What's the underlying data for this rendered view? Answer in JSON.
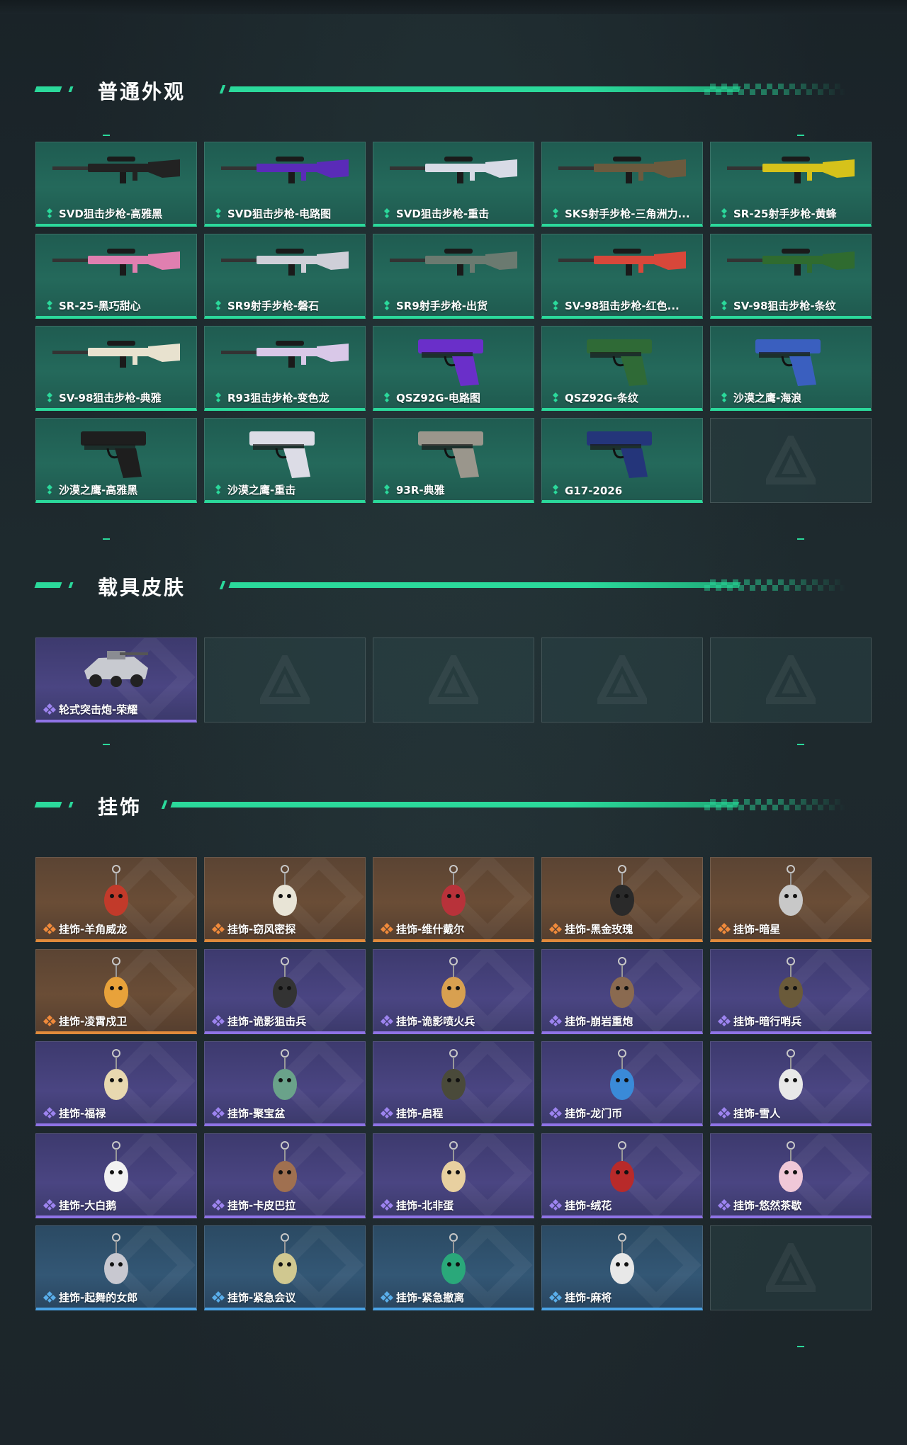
{
  "colors": {
    "accent": "#2bd99b",
    "common": "#2bd99b",
    "epic": "#8f73e6",
    "legendary": "#e08a3b",
    "rare": "#4aa3e6"
  },
  "sections": {
    "weapons": {
      "title": "普通外观",
      "items": [
        {
          "label": "SVD狙击步枪-高雅黑",
          "rarity": "green",
          "icon": "rifle-icon"
        },
        {
          "label": "SVD狙击步枪-电路图",
          "rarity": "green",
          "icon": "rifle-icon"
        },
        {
          "label": "SVD狙击步枪-重击",
          "rarity": "green",
          "icon": "rifle-icon"
        },
        {
          "label": "SKS射手步枪-三角洲力...",
          "rarity": "green",
          "icon": "rifle-icon"
        },
        {
          "label": "SR-25射手步枪-黄蜂",
          "rarity": "green",
          "icon": "rifle-icon"
        },
        {
          "label": "SR-25-黑巧甜心",
          "rarity": "green",
          "icon": "rifle-icon"
        },
        {
          "label": "SR9射手步枪-磐石",
          "rarity": "green",
          "icon": "rifle-icon"
        },
        {
          "label": "SR9射手步枪-出货",
          "rarity": "green",
          "icon": "rifle-icon"
        },
        {
          "label": "SV-98狙击步枪-红色...",
          "rarity": "green",
          "icon": "rifle-icon"
        },
        {
          "label": "SV-98狙击步枪-条纹",
          "rarity": "green",
          "icon": "rifle-icon"
        },
        {
          "label": "SV-98狙击步枪-典雅",
          "rarity": "green",
          "icon": "rifle-icon"
        },
        {
          "label": "R93狙击步枪-变色龙",
          "rarity": "green",
          "icon": "rifle-icon"
        },
        {
          "label": "QSZ92G-电路图",
          "rarity": "green",
          "icon": "pistol-icon"
        },
        {
          "label": "QSZ92G-条纹",
          "rarity": "green",
          "icon": "pistol-icon"
        },
        {
          "label": "沙漠之鹰-海浪",
          "rarity": "green",
          "icon": "pistol-icon"
        },
        {
          "label": "沙漠之鹰-高雅黑",
          "rarity": "green",
          "icon": "pistol-icon"
        },
        {
          "label": "沙漠之鹰-重击",
          "rarity": "green",
          "icon": "pistol-icon"
        },
        {
          "label": "93R-典雅",
          "rarity": "green",
          "icon": "pistol-icon"
        },
        {
          "label": "G17-2026",
          "rarity": "green",
          "icon": "pistol-icon"
        }
      ]
    },
    "vehicles": {
      "title": "载具皮肤",
      "items": [
        {
          "label": "轮式突击炮-荣耀",
          "rarity": "purple",
          "icon": "vehicle-icon"
        }
      ]
    },
    "charms": {
      "title": "挂饰",
      "items": [
        {
          "label": "挂饰-羊角威龙",
          "rarity": "orange",
          "icon": "charm-icon"
        },
        {
          "label": "挂饰-窃风密探",
          "rarity": "orange",
          "icon": "charm-icon"
        },
        {
          "label": "挂饰-维什戴尔",
          "rarity": "orange",
          "icon": "charm-icon"
        },
        {
          "label": "挂饰-黑金玫瑰",
          "rarity": "orange",
          "icon": "charm-icon"
        },
        {
          "label": "挂饰-暗星",
          "rarity": "orange",
          "icon": "charm-icon"
        },
        {
          "label": "挂饰-凌霄戍卫",
          "rarity": "orange",
          "icon": "charm-icon"
        },
        {
          "label": "挂饰-诡影狙击兵",
          "rarity": "purple",
          "icon": "charm-icon"
        },
        {
          "label": "挂饰-诡影喷火兵",
          "rarity": "purple",
          "icon": "charm-icon"
        },
        {
          "label": "挂饰-崩岩重炮",
          "rarity": "purple",
          "icon": "charm-icon"
        },
        {
          "label": "挂饰-暗行哨兵",
          "rarity": "purple",
          "icon": "charm-icon"
        },
        {
          "label": "挂饰-福禄",
          "rarity": "purple",
          "icon": "charm-icon"
        },
        {
          "label": "挂饰-聚宝盆",
          "rarity": "purple",
          "icon": "charm-icon"
        },
        {
          "label": "挂饰-启程",
          "rarity": "purple",
          "icon": "charm-icon"
        },
        {
          "label": "挂饰-龙门币",
          "rarity": "purple",
          "icon": "charm-icon"
        },
        {
          "label": "挂饰-雪人",
          "rarity": "purple",
          "icon": "charm-icon"
        },
        {
          "label": "挂饰-大白鹅",
          "rarity": "purple",
          "icon": "charm-icon"
        },
        {
          "label": "挂饰-卡皮巴拉",
          "rarity": "purple",
          "icon": "charm-icon"
        },
        {
          "label": "挂饰-北非蛋",
          "rarity": "purple",
          "icon": "charm-icon"
        },
        {
          "label": "挂饰-绒花",
          "rarity": "purple",
          "icon": "charm-icon"
        },
        {
          "label": "挂饰-悠然茶歇",
          "rarity": "purple",
          "icon": "charm-icon"
        },
        {
          "label": "挂饰-起舞的女郎",
          "rarity": "blue",
          "icon": "charm-icon"
        },
        {
          "label": "挂饰-紧急会议",
          "rarity": "blue",
          "icon": "charm-icon"
        },
        {
          "label": "挂饰-紧急撤离",
          "rarity": "blue",
          "icon": "charm-icon"
        },
        {
          "label": "挂饰-麻将",
          "rarity": "blue",
          "icon": "charm-icon"
        }
      ]
    }
  }
}
